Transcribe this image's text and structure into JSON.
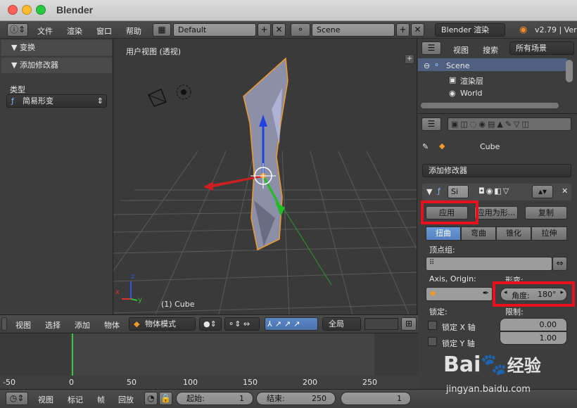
{
  "window": {
    "title": "Blender"
  },
  "infobar": {
    "menus": [
      "文件",
      "渲染",
      "窗口",
      "帮助"
    ],
    "layout": "Default",
    "scene": "Scene",
    "engine": "Blender 渲染",
    "version": "v2.79 | Ver"
  },
  "left_panel": {
    "transform": "▼ 变换",
    "add_modifier": "▼ 添加修改器",
    "type_label": "类型",
    "type_value": "简易形变"
  },
  "viewport": {
    "view_label": "用户视图 (透视)",
    "object_label": "(1) Cube",
    "axes": {
      "x": "x",
      "y": "y",
      "z": "z"
    }
  },
  "outliner": {
    "menus": [
      "视图",
      "搜索"
    ],
    "filter": "所有场景",
    "tree": [
      "Scene",
      "渲染层",
      "World"
    ]
  },
  "properties": {
    "object_name": "Cube",
    "add_modifier": "添加修改器",
    "modifier_short": "Si",
    "apply": "应用",
    "apply_as": "应用为形...",
    "copy": "复制",
    "tabs": [
      "扭曲",
      "弯曲",
      "锥化",
      "拉伸"
    ],
    "vertex_group": "顶点组:",
    "axis_origin": "Axis, Origin:",
    "deform": "形变:",
    "angle": "角度:",
    "angle_value": "180°",
    "lock": "锁定:",
    "limit": "限制:",
    "lock_x": "锁定 X 轴",
    "lock_y": "锁定 Y 轴",
    "limit_min": "0.00",
    "limit_max": "1.00"
  },
  "toolbar": {
    "menus": [
      "视图",
      "选择",
      "添加",
      "物体"
    ],
    "mode": "物体模式",
    "orientation": "全局"
  },
  "timeline": {
    "ticks": [
      "-50",
      "0",
      "50",
      "100",
      "150",
      "200",
      "250"
    ],
    "current_frame": 0
  },
  "bottombar": {
    "menus": [
      "视图",
      "标记",
      "帧",
      "回放"
    ],
    "start_label": "起始:",
    "start_value": "1",
    "end_label": "结束:",
    "end_value": "250",
    "current": "1"
  },
  "watermark": {
    "brand": "Bai",
    "brand2": "经验",
    "url": "jingyan.baidu.com"
  }
}
